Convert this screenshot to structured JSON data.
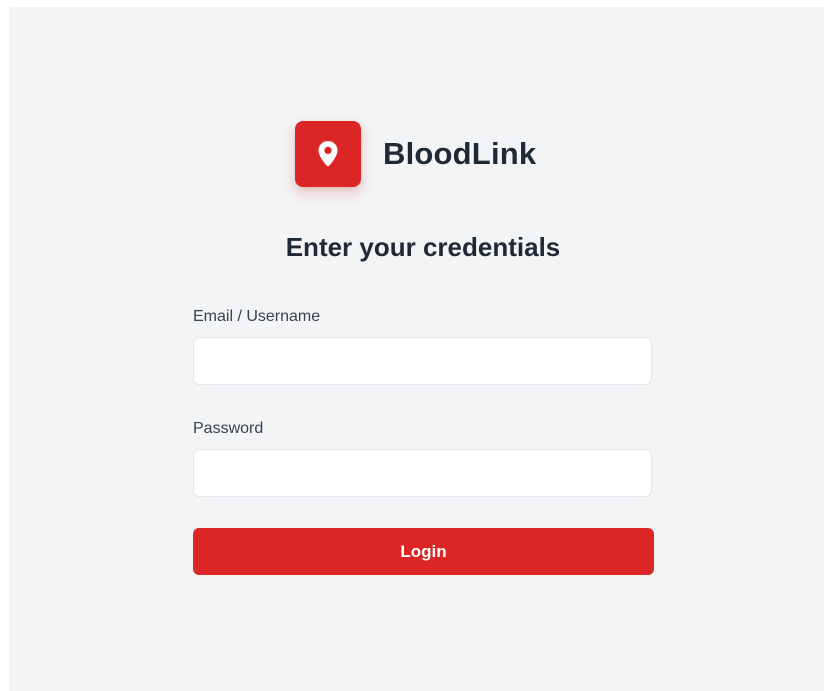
{
  "brand": {
    "name": "BloodLink",
    "logo_icon": "map-pin-icon",
    "accent_color": "#dc2626"
  },
  "form": {
    "heading": "Enter your credentials",
    "email": {
      "label": "Email / Username",
      "value": "",
      "placeholder": ""
    },
    "password": {
      "label": "Password",
      "value": "",
      "placeholder": ""
    },
    "submit_label": "Login"
  },
  "colors": {
    "background": "#f3f4f6",
    "text_dark": "#1f2937",
    "button": "#dc2626",
    "button_text": "#ffffff"
  }
}
